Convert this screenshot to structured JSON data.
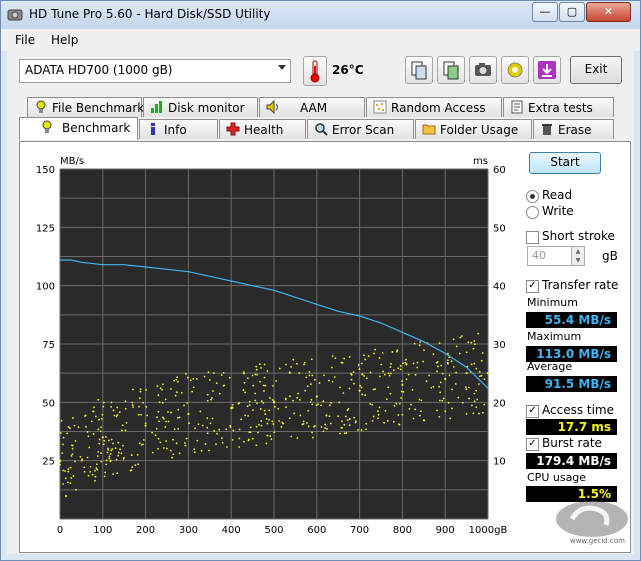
{
  "window": {
    "title": "HD Tune Pro 5.60 - Hard Disk/SSD Utility"
  },
  "titlebar_buttons": {
    "minimize": "—",
    "maximize": "▢",
    "close": "✕"
  },
  "menu": [
    "File",
    "Help"
  ],
  "toolbar": {
    "drive": "ADATA   HD700 (1000 gB)",
    "temperature": "26°C",
    "exit_label": "Exit",
    "icons": [
      "copy-info-icon",
      "copy-screen-icon",
      "screenshot-icon",
      "options-icon",
      "save-icon"
    ]
  },
  "tabs_top": [
    "File Benchmark",
    "Disk monitor",
    "AAM",
    "Random Access",
    "Extra tests"
  ],
  "tabs_bottom": [
    "Benchmark",
    "Info",
    "Health",
    "Error Scan",
    "Folder Usage",
    "Erase"
  ],
  "active_tab": "Benchmark",
  "sidebar": {
    "start_label": "Start",
    "read_label": "Read",
    "write_label": "Write",
    "short_stroke_label": "Short stroke",
    "short_stroke_value": "40",
    "short_stroke_unit": "gB",
    "transfer_rate_label": "Transfer rate",
    "minimum_label": "Minimum",
    "minimum_value": "55.4 MB/s",
    "maximum_label": "Maximum",
    "maximum_value": "113.0 MB/s",
    "average_label": "Average",
    "average_value": "91.5 MB/s",
    "access_time_label": "Access time",
    "access_time_value": "17.7 ms",
    "burst_rate_label": "Burst rate",
    "burst_rate_value": "179.4 MB/s",
    "cpu_usage_label": "CPU usage",
    "cpu_usage_value": "1.5%",
    "colors": {
      "metric_blue": "#3fb4f0",
      "metric_yellow": "#f5f51e",
      "metric_white": "#ffffff"
    }
  },
  "watermark": {
    "text": "www.gecid.com"
  },
  "chart_data": {
    "type": "line",
    "left_unit": "MB/s",
    "right_unit": "ms",
    "x_unit": "gB",
    "xlim": [
      0,
      1000
    ],
    "ylim_left": [
      0,
      150
    ],
    "ylim_right": [
      0,
      60
    ],
    "xticks": [
      "0",
      "100",
      "200",
      "300",
      "400",
      "500",
      "600",
      "700",
      "800",
      "900",
      "1000gB"
    ],
    "yticks_left": [
      "150",
      "125",
      "100",
      "75",
      "50",
      "25"
    ],
    "yticks_right": [
      "60",
      "50",
      "40",
      "30",
      "20",
      "10"
    ],
    "grid": true,
    "background": "#2a2a2a",
    "series": [
      {
        "axis": "left",
        "color": "#3fb4f0",
        "x": [
          0,
          25,
          50,
          100,
          150,
          200,
          250,
          300,
          350,
          400,
          450,
          500,
          550,
          600,
          650,
          700,
          750,
          800,
          850,
          900,
          950,
          1000
        ],
        "y": [
          111,
          111,
          110,
          109,
          109,
          108,
          107,
          106,
          104,
          102,
          100,
          98,
          95,
          92,
          89,
          87,
          84,
          80,
          76,
          71,
          65,
          56
        ]
      },
      {
        "axis": "right",
        "type": "scatter",
        "color": "#f5f51e",
        "x": [
          0,
          100,
          200,
          300,
          400,
          500,
          600,
          700,
          800,
          900,
          950,
          1000
        ],
        "y": [
          10,
          14,
          16,
          18,
          19,
          20,
          21,
          22,
          23,
          24,
          25,
          25
        ]
      }
    ]
  }
}
